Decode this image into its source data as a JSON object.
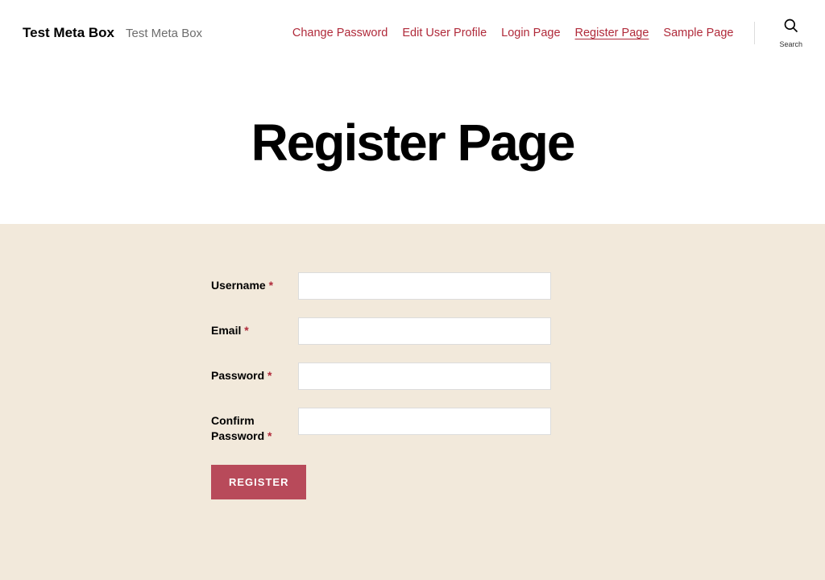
{
  "header": {
    "site_title": "Test Meta Box",
    "site_tagline": "Test Meta Box",
    "nav": [
      {
        "label": "Change Password",
        "current": false
      },
      {
        "label": "Edit User Profile",
        "current": false
      },
      {
        "label": "Login Page",
        "current": false
      },
      {
        "label": "Register Page",
        "current": true
      },
      {
        "label": "Sample Page",
        "current": false
      }
    ],
    "search_label": "Search"
  },
  "page": {
    "title": "Register Page"
  },
  "form": {
    "fields": {
      "username": {
        "label": "Username",
        "required": "*",
        "value": ""
      },
      "email": {
        "label": "Email",
        "required": "*",
        "value": ""
      },
      "password": {
        "label": "Password",
        "required": "*",
        "value": ""
      },
      "confirm_password": {
        "label": "Confirm Password",
        "required": "*",
        "value": ""
      }
    },
    "submit_label": "REGISTER"
  },
  "colors": {
    "accent": "#b02a3a",
    "button": "#b84a5a",
    "form_bg": "#f2e9db"
  }
}
